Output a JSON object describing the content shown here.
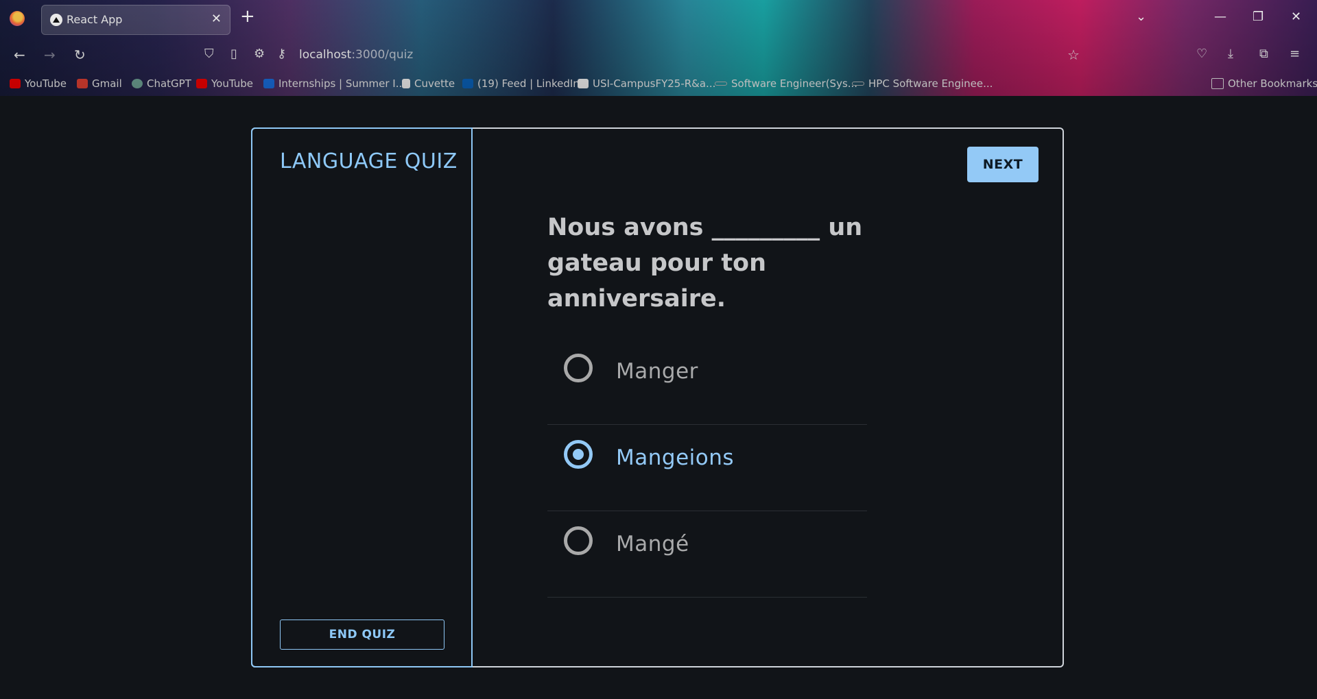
{
  "browser": {
    "tab": {
      "title": "React App",
      "close": "✕"
    },
    "new_tab": "+",
    "window": {
      "tabs_menu": "⌄",
      "minimize": "—",
      "restore": "❐",
      "close": "✕"
    },
    "nav": {
      "back": "←",
      "forward": "→",
      "reload": "↻",
      "url_host": "localhost",
      "url_path": ":3000/quiz",
      "star": "☆"
    },
    "bookmarks": [
      {
        "label": "YouTube",
        "color": "#ff0000"
      },
      {
        "label": "Gmail",
        "color": "#ea4335"
      },
      {
        "label": "ChatGPT",
        "color": "#74aa9c"
      },
      {
        "label": "YouTube",
        "color": "#ff0000"
      },
      {
        "label": "Internships | Summer I...",
        "color": "#1a73e8"
      },
      {
        "label": "Cuvette",
        "color": "#ffffff"
      },
      {
        "label": "(19) Feed | LinkedIn",
        "color": "#0a66c2"
      },
      {
        "label": "USI-CampusFY25-R&a...",
        "color": "#ffffff"
      },
      {
        "label": "Software Engineer(Sys...",
        "color": "#bbbbbb"
      },
      {
        "label": "HPC Software Enginee...",
        "color": "#bbbbbb"
      }
    ],
    "other_bookmarks": "Other Bookmarks"
  },
  "quiz": {
    "title": "LANGUAGE QUIZ",
    "end_label": "END QUIZ",
    "next_label": "NEXT",
    "question": "Nous avons _________ un gateau pour ton anniversaire.",
    "options": [
      {
        "label": "Manger",
        "selected": false
      },
      {
        "label": "Mangeions",
        "selected": true
      },
      {
        "label": "Mangé",
        "selected": false
      }
    ]
  },
  "colors": {
    "accent": "#93c9f6",
    "background": "#111418",
    "text": "#c6c7c9"
  }
}
